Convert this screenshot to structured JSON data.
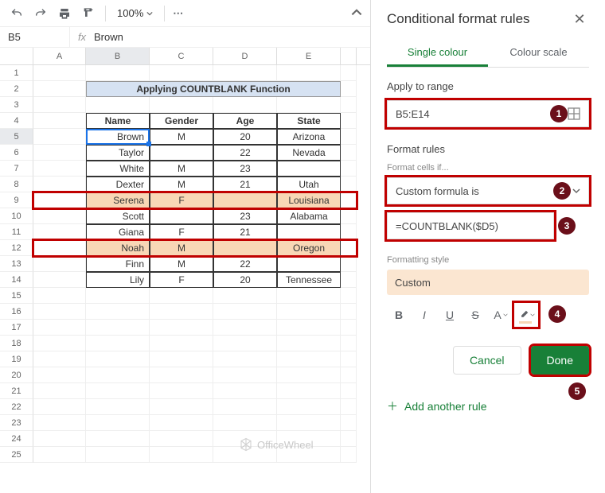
{
  "toolbar": {
    "zoom": "100%"
  },
  "name_box": "B5",
  "formula_bar": "Brown",
  "columns": [
    "A",
    "B",
    "C",
    "D",
    "E"
  ],
  "row_count": 25,
  "title_text": "Applying COUNTBLANK Function",
  "table": {
    "headers": [
      "Name",
      "Gender",
      "Age",
      "State"
    ],
    "rows": [
      {
        "name": "Brown",
        "gender": "M",
        "age": "20",
        "state": "Arizona",
        "hl": false,
        "red": false,
        "active": true
      },
      {
        "name": "Taylor",
        "gender": "",
        "age": "22",
        "state": "Nevada",
        "hl": false,
        "red": false
      },
      {
        "name": "White",
        "gender": "M",
        "age": "23",
        "state": "",
        "hl": false,
        "red": false
      },
      {
        "name": "Dexter",
        "gender": "M",
        "age": "21",
        "state": "Utah",
        "hl": false,
        "red": false
      },
      {
        "name": "Serena",
        "gender": "F",
        "age": "",
        "state": "Louisiana",
        "hl": true,
        "red": true
      },
      {
        "name": "Scott",
        "gender": "",
        "age": "23",
        "state": "Alabama",
        "hl": false,
        "red": false
      },
      {
        "name": "Giana",
        "gender": "F",
        "age": "21",
        "state": "",
        "hl": false,
        "red": false
      },
      {
        "name": "Noah",
        "gender": "M",
        "age": "",
        "state": "Oregon",
        "hl": true,
        "red": true
      },
      {
        "name": "Finn",
        "gender": "M",
        "age": "22",
        "state": "",
        "hl": false,
        "red": false
      },
      {
        "name": "Lily",
        "gender": "F",
        "age": "20",
        "state": "Tennessee",
        "hl": false,
        "red": false
      }
    ]
  },
  "watermark": "OfficeWheel",
  "sidebar": {
    "title": "Conditional format rules",
    "tabs": {
      "single": "Single colour",
      "scale": "Colour scale"
    },
    "apply_label": "Apply to range",
    "range": "B5:E14",
    "rules_label": "Format rules",
    "cells_if_label": "Format cells if...",
    "condition": "Custom formula is",
    "formula": "=COUNTBLANK($D5)",
    "style_label": "Formatting style",
    "style_name": "Custom",
    "cancel": "Cancel",
    "done": "Done",
    "add_rule": "Add another rule"
  },
  "badges": {
    "b1": "1",
    "b2": "2",
    "b3": "3",
    "b4": "4",
    "b5": "5"
  }
}
